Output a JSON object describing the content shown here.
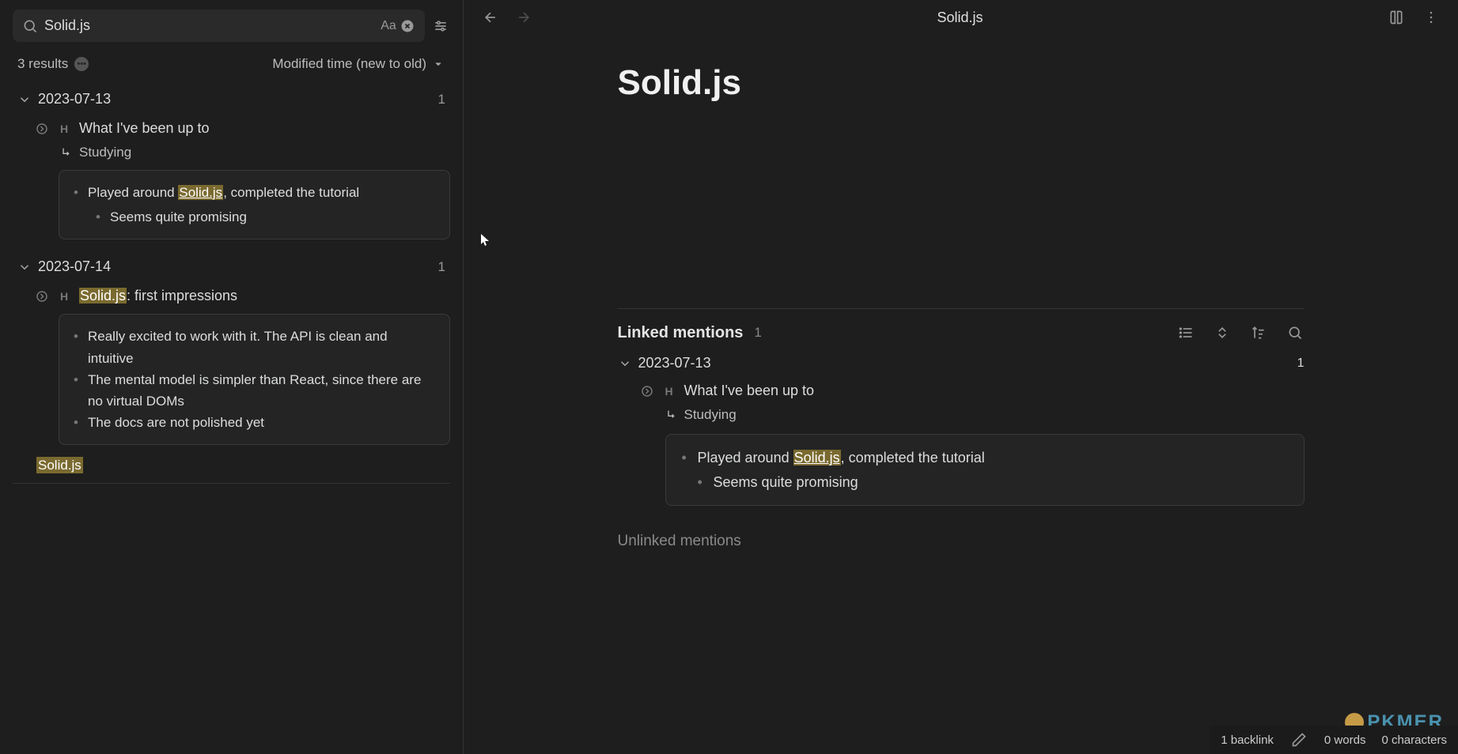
{
  "search": {
    "query": "Solid.js",
    "results_label": "3 results",
    "sort_label": "Modified time (new to old)"
  },
  "groups": [
    {
      "date": "2023-07-13",
      "count": "1",
      "note": {
        "title": "What I've been up to",
        "breadcrumb": "Studying",
        "lines": [
          {
            "before": "Played around ",
            "hl": "Solid.js",
            "after": ", completed the tutorial",
            "sub": "Seems quite promising"
          }
        ]
      }
    },
    {
      "date": "2023-07-14",
      "count": "1",
      "note": {
        "title_hl": "Solid.js",
        "title_after": ": first impressions",
        "lines": [
          {
            "text": "Really excited to work with it. The API is clean and intuitive"
          },
          {
            "text": "The mental model is simpler than React, since there are no virtual DOMs"
          },
          {
            "text": "The docs are not polished yet"
          }
        ]
      }
    }
  ],
  "file_result": "Solid.js",
  "topbar": {
    "title": "Solid.js"
  },
  "page": {
    "title": "Solid.js"
  },
  "linked": {
    "label": "Linked mentions",
    "count": "1",
    "date": "2023-07-13",
    "date_count": "1",
    "note_title": "What I've been up to",
    "breadcrumb": "Studying",
    "line_before": "Played around ",
    "line_hl": "Solid.js",
    "line_after": ", completed the tutorial",
    "sub": "Seems quite promising"
  },
  "unlinked": {
    "label": "Unlinked mentions"
  },
  "status": {
    "backlinks": "1 backlink",
    "words": "0 words",
    "chars": "0 characters"
  },
  "watermark": "PKMER"
}
